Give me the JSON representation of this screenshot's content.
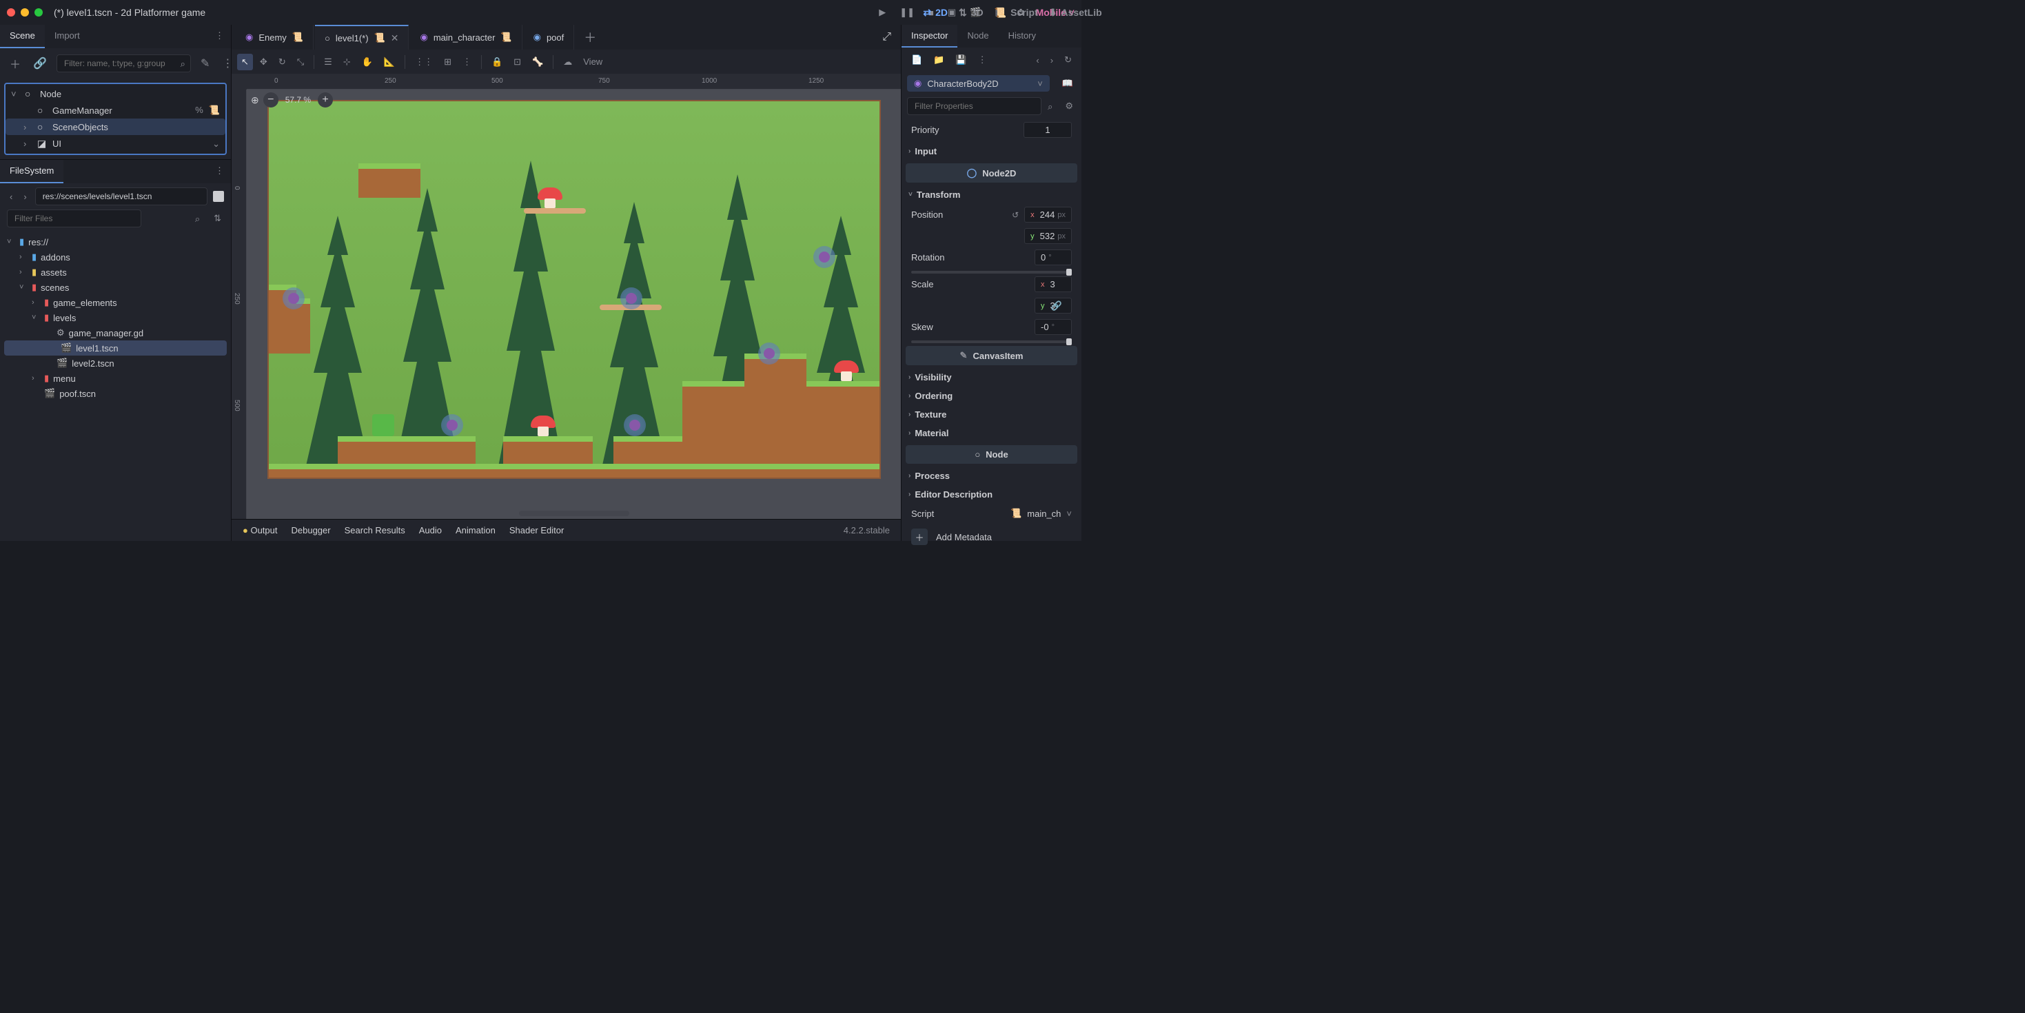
{
  "titlebar": {
    "title": "(*) level1.tscn - 2d Platformer game",
    "modes": {
      "2d": "2D",
      "3d": "3D",
      "script": "Script",
      "assetlib": "AssetLib"
    },
    "mobile": "Mobile"
  },
  "scene_dock": {
    "tabs": {
      "scene": "Scene",
      "import": "Import"
    },
    "filter_placeholder": "Filter: name, t:type, g:group",
    "tree": [
      {
        "name": "Node",
        "indent": 0,
        "expand": true,
        "icon": "○"
      },
      {
        "name": "GameManager",
        "indent": 1,
        "icon": "○",
        "extras": [
          "%",
          "scr"
        ]
      },
      {
        "name": "SceneObjects",
        "indent": 1,
        "icon": "○",
        "chev": true,
        "selected": true
      },
      {
        "name": "UI",
        "indent": 1,
        "icon": "◪",
        "chev": true,
        "extras": [
          "vis"
        ]
      }
    ]
  },
  "filesystem_dock": {
    "title": "FileSystem",
    "path": "res://scenes/levels/level1.tscn",
    "filter_placeholder": "Filter Files",
    "tree": [
      {
        "name": "res://",
        "indent": 0,
        "type": "folder-blue",
        "expand": "open"
      },
      {
        "name": "addons",
        "indent": 1,
        "type": "folder-blue",
        "expand": "closed"
      },
      {
        "name": "assets",
        "indent": 1,
        "type": "folder-yellow",
        "expand": "closed"
      },
      {
        "name": "scenes",
        "indent": 1,
        "type": "folder-red",
        "expand": "open"
      },
      {
        "name": "game_elements",
        "indent": 2,
        "type": "folder-red",
        "expand": "closed"
      },
      {
        "name": "levels",
        "indent": 2,
        "type": "folder-red",
        "expand": "open"
      },
      {
        "name": "game_manager.gd",
        "indent": 3,
        "type": "file-gear"
      },
      {
        "name": "level1.tscn",
        "indent": 3,
        "type": "file-scene",
        "selected": true
      },
      {
        "name": "level2.tscn",
        "indent": 3,
        "type": "file-scene"
      },
      {
        "name": "menu",
        "indent": 2,
        "type": "folder-red",
        "expand": "closed"
      },
      {
        "name": "poof.tscn",
        "indent": 2,
        "type": "file-scene"
      }
    ]
  },
  "scene_tabs": [
    {
      "name": "Enemy",
      "icon": "◉",
      "color": "#a878e8",
      "script": true
    },
    {
      "name": "level1(*)",
      "icon": "○",
      "active": true,
      "script": true,
      "closable": true
    },
    {
      "name": "main_character",
      "icon": "◉",
      "color": "#a878e8",
      "script": true
    },
    {
      "name": "poof",
      "icon": "◉",
      "color": "#78a8e8"
    }
  ],
  "editor_toolbar": {
    "tools": [
      "select",
      "move",
      "rotate",
      "scale",
      "list",
      "ruler",
      "pan",
      "measure",
      "grid",
      "snap",
      "more",
      "lock",
      "group",
      "ungroup",
      "bone"
    ],
    "view": "View"
  },
  "viewport": {
    "zoom": "57.7 %",
    "ruler_h": [
      "0",
      "250",
      "500",
      "750",
      "1000",
      "1250"
    ],
    "ruler_v": [
      "0",
      "250",
      "500"
    ]
  },
  "bottom_panel": {
    "items": [
      "Output",
      "Debugger",
      "Search Results",
      "Audio",
      "Animation",
      "Shader Editor"
    ],
    "version": "4.2.2.stable"
  },
  "inspector": {
    "tabs": {
      "inspector": "Inspector",
      "node": "Node",
      "history": "History"
    },
    "object_type": "CharacterBody2D",
    "filter_placeholder": "Filter Properties",
    "priority": {
      "label": "Priority",
      "value": "1"
    },
    "sections": {
      "input": "Input",
      "node2d": "Node2D",
      "transform": "Transform",
      "canvasitem": "CanvasItem",
      "visibility": "Visibility",
      "ordering": "Ordering",
      "texture": "Texture",
      "material": "Material",
      "node": "Node",
      "process": "Process",
      "editor_desc": "Editor Description"
    },
    "transform": {
      "position": {
        "label": "Position",
        "x": "244",
        "y": "532",
        "unit": "px"
      },
      "rotation": {
        "label": "Rotation",
        "value": "0",
        "unit": "°"
      },
      "scale": {
        "label": "Scale",
        "x": "3",
        "y": "3"
      },
      "skew": {
        "label": "Skew",
        "value": "-0",
        "unit": "°"
      }
    },
    "script": {
      "label": "Script",
      "value": "main_ch"
    },
    "add_metadata": "Add Metadata"
  }
}
